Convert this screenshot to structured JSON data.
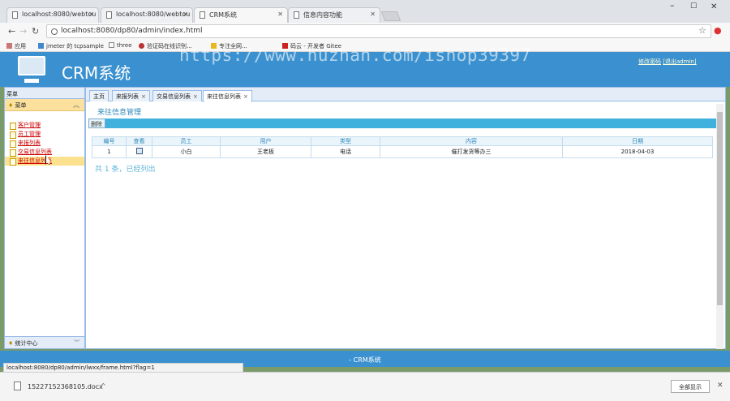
{
  "browser": {
    "tabs": [
      {
        "label": "localhost:8080/webtou"
      },
      {
        "label": "localhost:8080/webtou"
      },
      {
        "label": "CRM系统"
      },
      {
        "label": "信息内容功能"
      }
    ],
    "window_controls": {
      "minimize": "–",
      "maximize": "☐",
      "close": "✕"
    },
    "url": "localhost:8080/dp80/admin/index.html",
    "bookmarks": [
      {
        "label": "应用"
      },
      {
        "label": "jmeter 的 tcpsample"
      },
      {
        "label": "three"
      },
      {
        "label": "验证码在线识别..."
      },
      {
        "label": "专注全网..."
      },
      {
        "label": "码云 - 开发者 Gitee"
      }
    ]
  },
  "watermark": "https://www.huzhan.com/ishop39397",
  "header": {
    "title": "CRM系统",
    "links": {
      "change_password": "修改密码",
      "logout": "[退出admin]"
    }
  },
  "sidebar": {
    "title": "菜单",
    "group": "菜单",
    "items": [
      {
        "label": "客户管理"
      },
      {
        "label": "员工管理"
      },
      {
        "label": "来报列表"
      },
      {
        "label": "交易信息列表"
      },
      {
        "label": "来往信息列表"
      }
    ],
    "bottom_group": "统计中心"
  },
  "main": {
    "tabs": [
      {
        "label": "主页"
      },
      {
        "label": "来报列表"
      },
      {
        "label": "交易信息列表"
      },
      {
        "label": "来往信息列表"
      }
    ],
    "page_title": "来往信息管理",
    "toolbar_button": "删除",
    "table": {
      "headers": [
        "编号",
        "查看",
        "员工",
        "用户",
        "类型",
        "内容",
        "日期"
      ],
      "rows": [
        {
          "id": "1",
          "employee": "小白",
          "user": "王老板",
          "type": "电话",
          "content": "催打发货等办三",
          "date": "2018-04-03"
        }
      ]
    },
    "summary": "共 1 条，已经列出"
  },
  "footer": "- CRM系统",
  "status_url": "localhost:8080/dp80/admin/lwxx/frame.html?flag=1",
  "downloads": {
    "file": "15227152368105.docx",
    "arrow": "^",
    "show_all": "全部显示",
    "close": "✕"
  },
  "colors": {
    "header_blue": "#3b91cf",
    "menu_yellow": "#fbe19d",
    "toolbar_blue": "#3fb1dc"
  }
}
